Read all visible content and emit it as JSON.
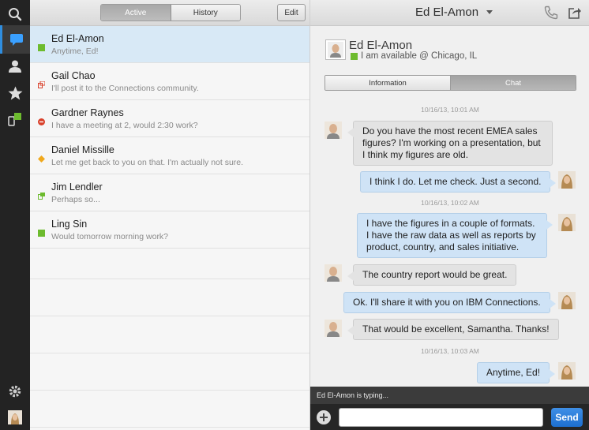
{
  "list_header": {
    "tab_active": "Active",
    "tab_history": "History",
    "edit": "Edit"
  },
  "conversations": [
    {
      "name": "Ed El-Amon",
      "message": "Anytime, Ed!",
      "status": "available"
    },
    {
      "name": "Gail Chao",
      "message": "I'll post it to the Connections community.",
      "status": "mobile"
    },
    {
      "name": "Gardner Raynes",
      "message": "I have a meeting at 2, would 2:30 work?",
      "status": "dnd"
    },
    {
      "name": "Daniel Missille",
      "message": "Let me get back to you on that. I'm actually not sure.",
      "status": "away"
    },
    {
      "name": "Jim Lendler",
      "message": "Perhaps so...",
      "status": "mobile"
    },
    {
      "name": "Ling Sin",
      "message": "Would tomorrow morning work?",
      "status": "available"
    }
  ],
  "chat": {
    "title": "Ed El-Amon",
    "profile_name": "Ed El-Amon",
    "profile_status": "I am available @ Chicago, IL",
    "tab_information": "Information",
    "tab_chat": "Chat",
    "timestamps": [
      "10/16/13, 10:01 AM",
      "10/16/13, 10:02 AM",
      "10/16/13, 10:03 AM"
    ],
    "messages": [
      {
        "dir": "in",
        "text": "Do you have the most recent EMEA sales figures? I'm working on a presentation, but I think my figures are old."
      },
      {
        "dir": "out",
        "text": "I think I do. Let me check. Just a second."
      },
      {
        "dir": "out",
        "text": "I have the figures in a couple of formats. I have the raw data as well as reports by product, country, and sales initiative."
      },
      {
        "dir": "in",
        "text": "The country report would be great."
      },
      {
        "dir": "out",
        "text": "Ok. I'll share it with you on IBM Connections."
      },
      {
        "dir": "in",
        "text": "That would be excellent, Samantha. Thanks!"
      },
      {
        "dir": "out",
        "text": "Anytime, Ed!"
      }
    ],
    "typing": "Ed El-Amon is typing...",
    "send": "Send"
  },
  "colors": {
    "available": "#6dbb2e",
    "dnd": "#d9412b",
    "away": "#f0a81c",
    "accent": "#2f8ee0"
  }
}
